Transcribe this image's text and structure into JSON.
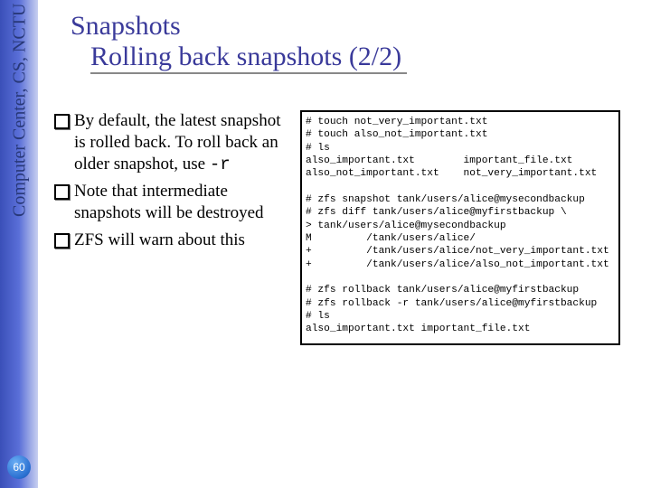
{
  "sidebar": {
    "label": "Computer Center, CS, NCTU"
  },
  "title": {
    "line1": "Snapshots",
    "line2": "Rolling back snapshots (2/2)"
  },
  "bullets": {
    "b1_pre": "By default, the latest snapshot is rolled back. To roll back an older snapshot, use ",
    "b1_code": "-r",
    "b2": "Note that intermediate snapshots will be destroyed",
    "b3": "ZFS will warn about this"
  },
  "terminal": "# touch not_very_important.txt\n# touch also_not_important.txt\n# ls\nalso_important.txt        important_file.txt\nalso_not_important.txt    not_very_important.txt\n\n# zfs snapshot tank/users/alice@mysecondbackup\n# zfs diff tank/users/alice@myfirstbackup \\\n> tank/users/alice@mysecondbackup\nM         /tank/users/alice/\n+         /tank/users/alice/not_very_important.txt\n+         /tank/users/alice/also_not_important.txt\n\n# zfs rollback tank/users/alice@myfirstbackup\n# zfs rollback -r tank/users/alice@myfirstbackup\n# ls\nalso_important.txt important_file.txt",
  "page_number": "60"
}
